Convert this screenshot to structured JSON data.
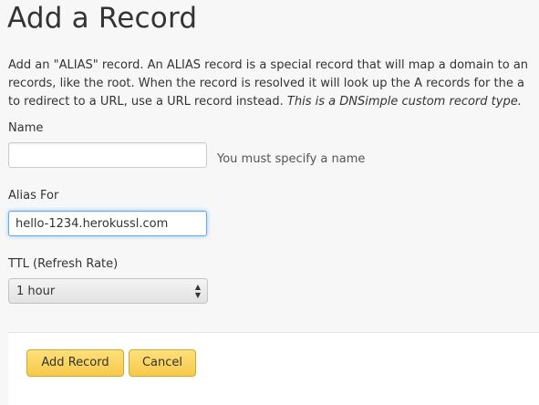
{
  "page": {
    "title": "Add a Record"
  },
  "description": {
    "line1": "Add an \"ALIAS\" record. An ALIAS record is a special record that will map a domain to an",
    "line2": "records, like the root. When the record is resolved it will look up the A records for the a",
    "line3_plain": "to redirect to a URL, use a URL record instead. ",
    "line3_italic": "This is a DNSimple custom record type."
  },
  "form": {
    "name": {
      "label": "Name",
      "value": "",
      "placeholder": "",
      "help": "You must specify a name"
    },
    "alias_for": {
      "label": "Alias For",
      "value": "hello-1234.herokussl.com"
    },
    "ttl": {
      "label": "TTL (Refresh Rate)",
      "selected": "1 hour",
      "arrow_up": "▲",
      "arrow_down": "▼"
    }
  },
  "actions": {
    "add_label": "Add Record",
    "cancel_label": "Cancel"
  },
  "colors": {
    "button_bg": "#f7c94a",
    "focus_border": "#6aa9e9",
    "background": "#f7f7f7"
  }
}
